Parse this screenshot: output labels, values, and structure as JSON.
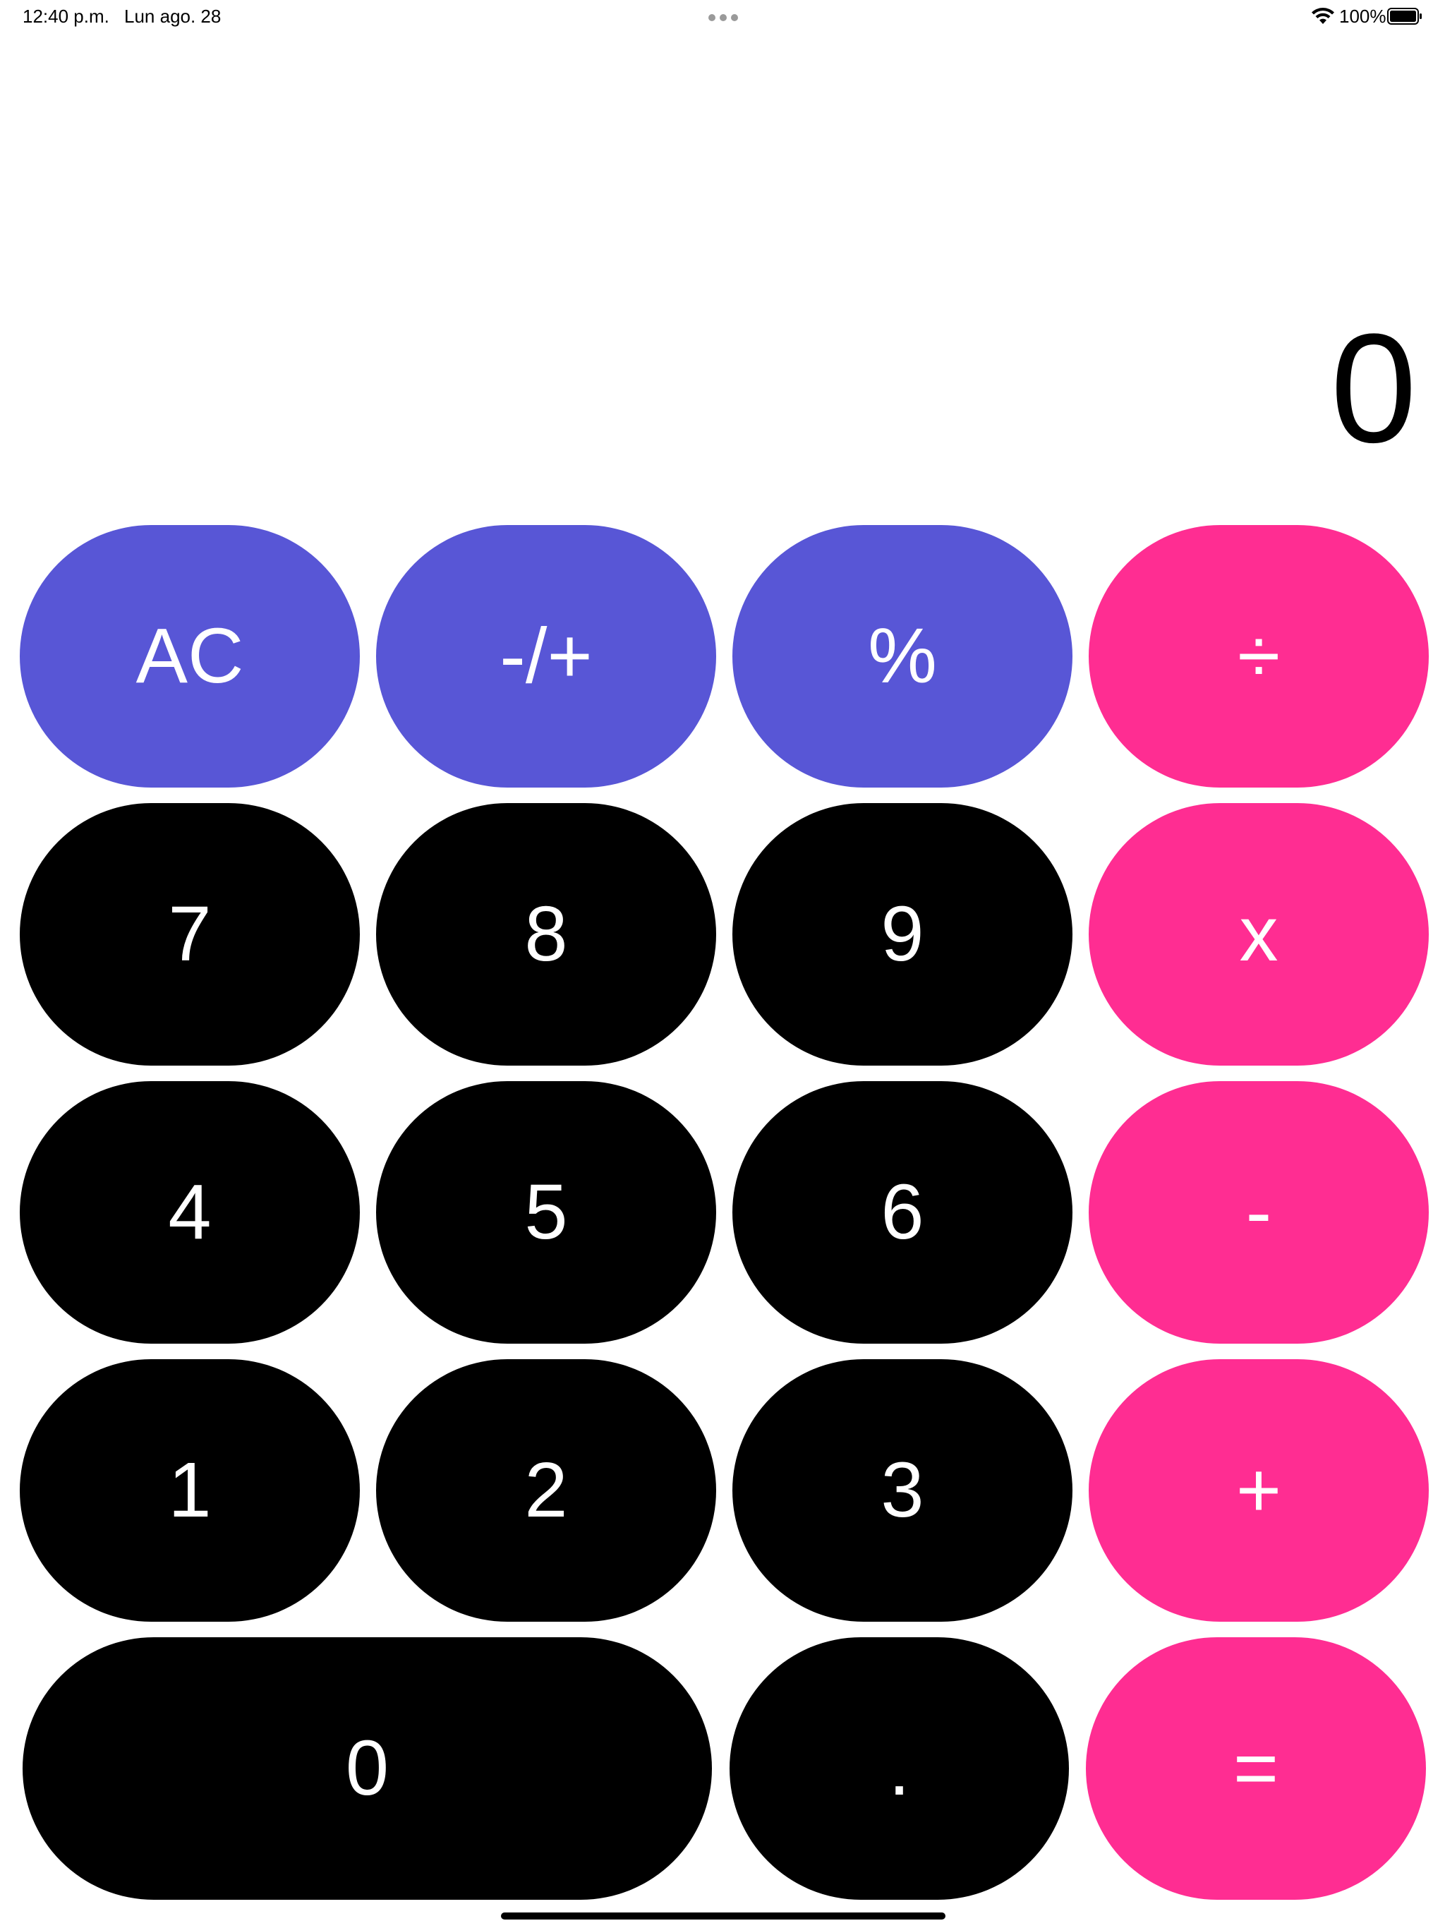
{
  "status_bar": {
    "time": "12:40 p.m.",
    "date": "Lun ago. 28",
    "battery_percent": "100%",
    "wifi_icon": "wifi-icon",
    "battery_icon": "battery-full-icon"
  },
  "display": {
    "value": "0"
  },
  "keys": {
    "ac": "AC",
    "negate": "-/+",
    "percent": "%",
    "divide": "÷",
    "seven": "7",
    "eight": "8",
    "nine": "9",
    "multiply": "x",
    "four": "4",
    "five": "5",
    "six": "6",
    "subtract": "-",
    "one": "1",
    "two": "2",
    "three": "3",
    "add": "+",
    "zero": "0",
    "decimal": ".",
    "equals": "="
  },
  "colors": {
    "function_keys": "#5856d6",
    "operator_keys": "#ff2d92",
    "number_keys": "#000000",
    "key_text": "#ffffff",
    "background": "#ffffff"
  }
}
